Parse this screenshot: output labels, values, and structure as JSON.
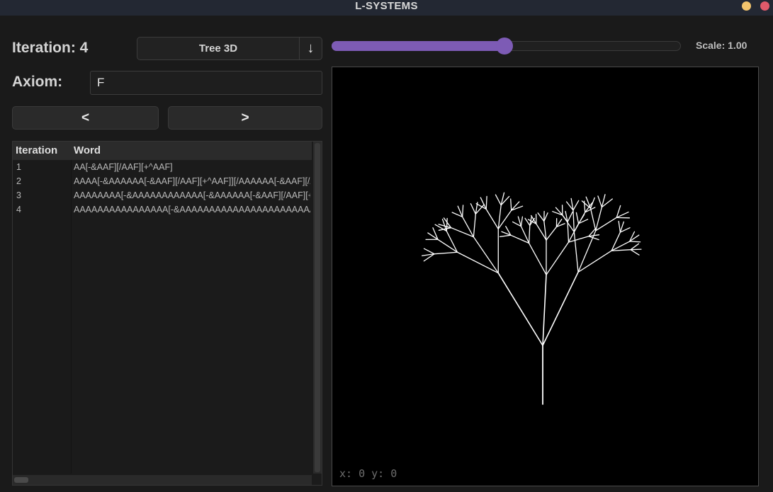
{
  "window": {
    "title": "L-SYSTEMS"
  },
  "controls": {
    "iteration_label": "Iteration: 4",
    "preset_value": "Tree 3D",
    "preset_arrow": "↓",
    "axiom_label": "Axiom:",
    "axiom_value": "F",
    "prev_label": "<",
    "next_label": ">"
  },
  "table": {
    "headers": [
      "Iteration",
      "Word"
    ],
    "rows": [
      {
        "iteration": "1",
        "word": "AA[-&AAF][/AAF][+^AAF]"
      },
      {
        "iteration": "2",
        "word": "AAAA[-&AAAAAA[-&AAF][/AAF][+^AAF]][/AAAAAA[-&AAF][/AAF][+^AAF]][+^AAAAAA[-&AAF][/AAF][+^AAF]]"
      },
      {
        "iteration": "3",
        "word": "AAAAAAAA[-&AAAAAAAAAAAA[-&AAAAAA[-&AAF][/AAF][+^AAF]][/AAAAAA[-&AAF][/AAF][+^AAF]]"
      },
      {
        "iteration": "4",
        "word": "AAAAAAAAAAAAAAAA[-&AAAAAAAAAAAAAAAAAAAAAAAA[-&AAAAAAAAAAAA"
      }
    ]
  },
  "scale": {
    "label": "Scale: 1.00",
    "slider_fraction": 0.495,
    "accent_color": "#7d5bb5"
  },
  "canvas": {
    "coords": "x: 0 y: 0",
    "line_color": "#ffffff",
    "background": "#000000"
  }
}
